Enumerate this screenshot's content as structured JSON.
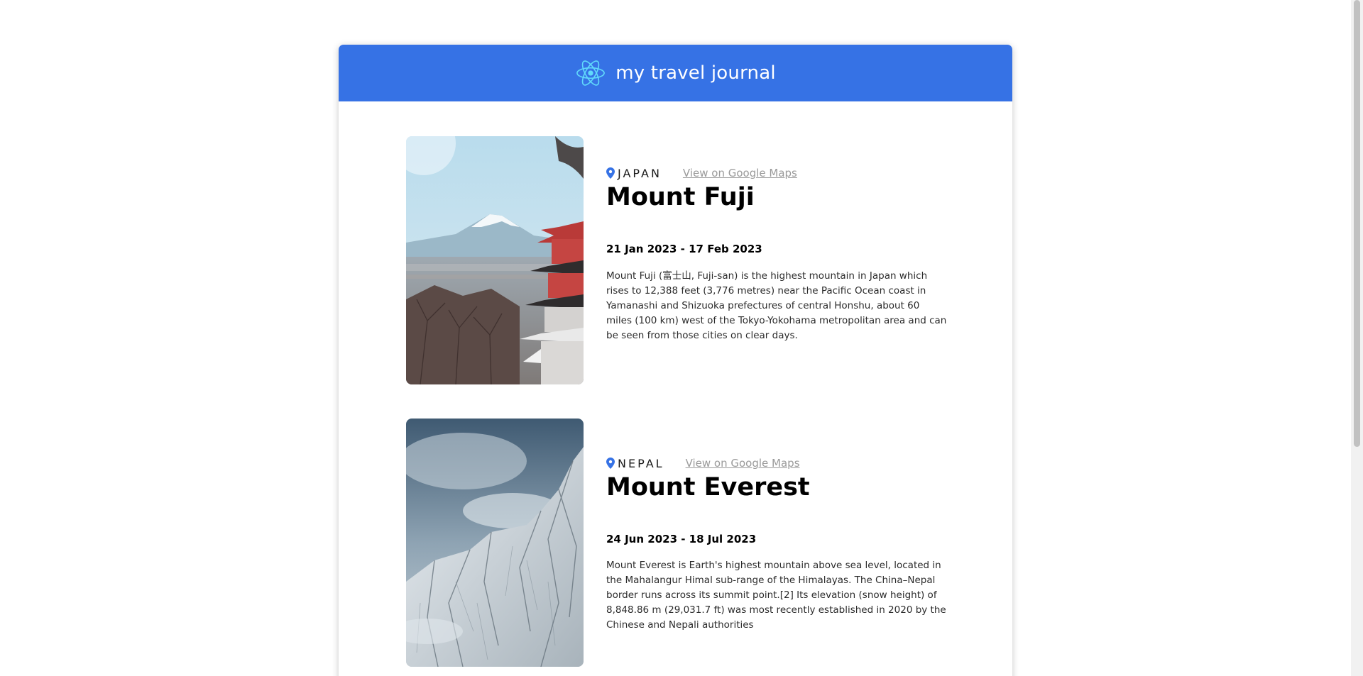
{
  "header": {
    "title": "my travel journal"
  },
  "entries": [
    {
      "country": "JAPAN",
      "maps_link": "View on Google Maps",
      "title": "Mount Fuji",
      "dates": "21 Jan 2023 - 17 Feb 2023",
      "description": "Mount Fuji (富士山, Fuji-san) is the highest mountain in Japan which rises to 12,388 feet (3,776 metres) near the Pacific Ocean coast in Yamanashi and Shizuoka prefectures of central Honshu, about 60 miles (100 km) west of the Tokyo-Yokohama metropolitan area and can be seen from those cities on clear days."
    },
    {
      "country": "NEPAL",
      "maps_link": "View on Google Maps",
      "title": "Mount Everest",
      "dates": "24 Jun 2023 - 18 Jul 2023",
      "description": "Mount Everest is Earth's highest mountain above sea level, located in the Mahalangur Himal sub-range of the Himalayas. The China–Nepal border runs across its summit point.[2] Its elevation (snow height) of 8,848.86 m (29,031.7 ft) was most recently established in 2020 by the Chinese and Nepali authorities"
    }
  ],
  "colors": {
    "header_bg": "#3672e5",
    "accent_pin": "#3672e5",
    "link": "#9a9a9a",
    "logo": "#61dafb"
  },
  "icons": {
    "logo": "react-atom-icon",
    "location": "location-pin-icon"
  }
}
